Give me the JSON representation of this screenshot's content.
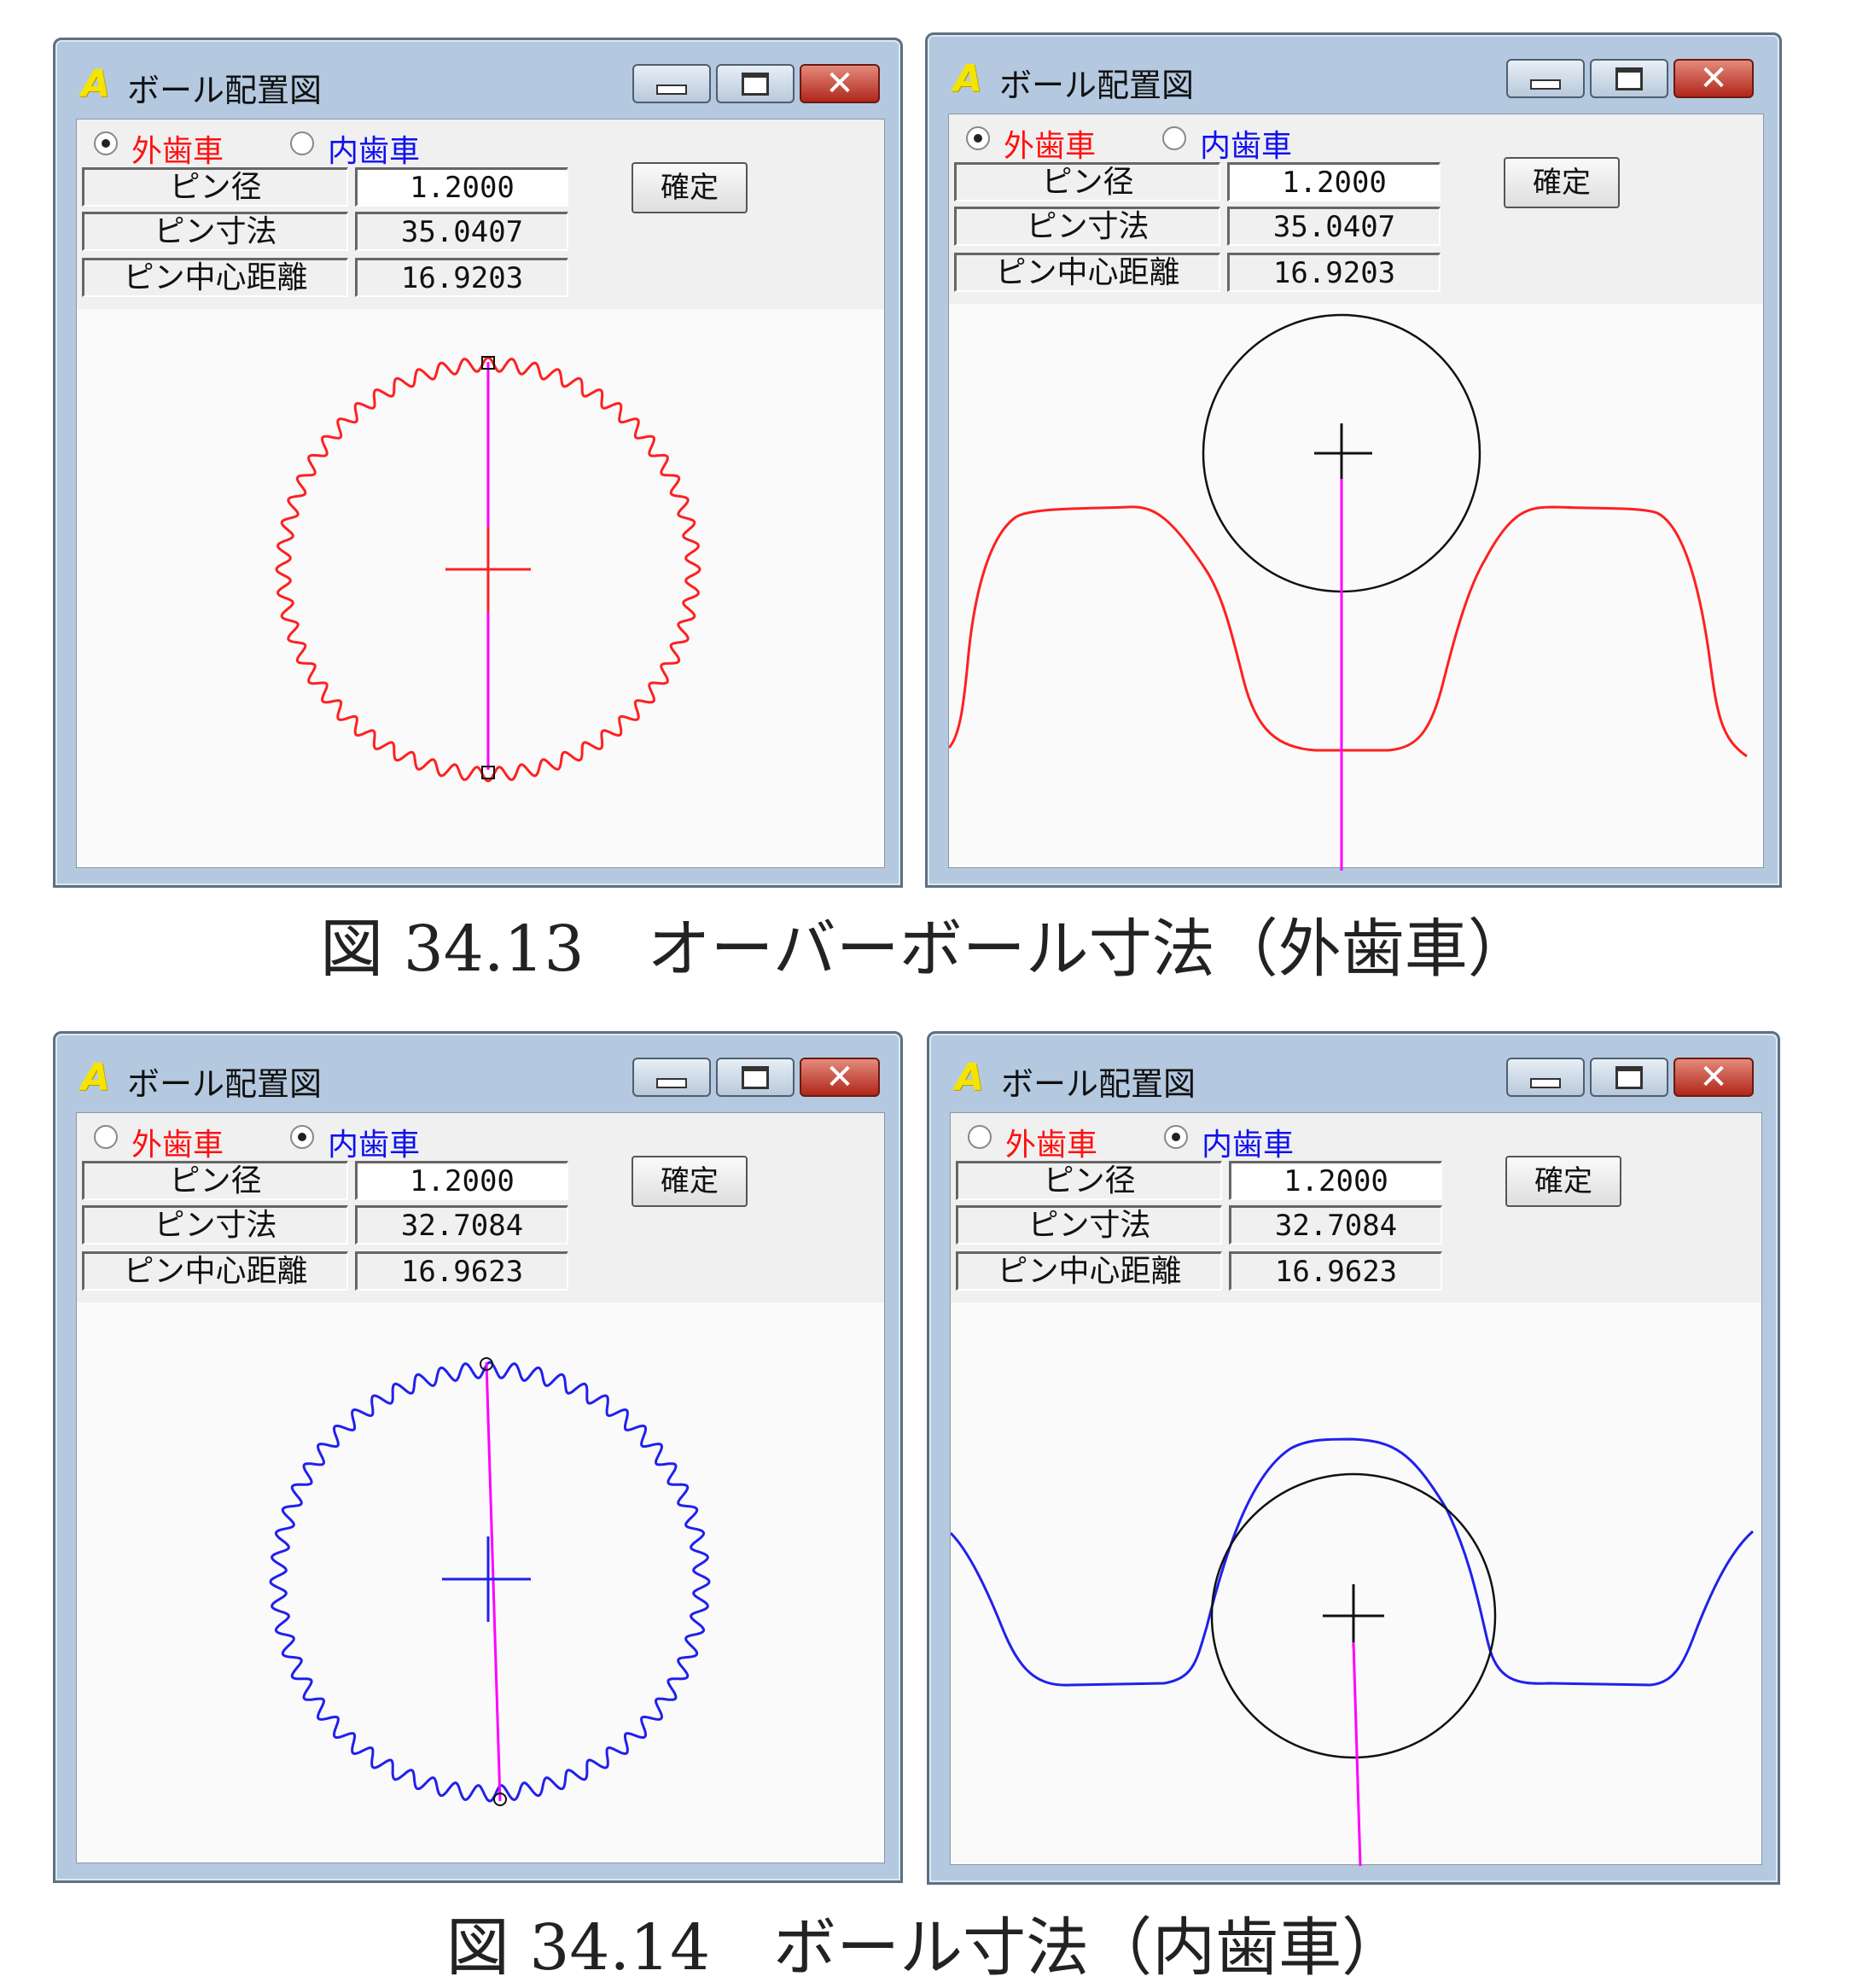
{
  "windows": [
    {
      "title": "ボール配置図",
      "radio_external": "外歯車",
      "radio_internal": "内歯車",
      "selected": "external",
      "fields": [
        {
          "label": "ピン径",
          "value": "1.2000"
        },
        {
          "label": "ピン寸法",
          "value": "35.0407"
        },
        {
          "label": "ピン中心距離",
          "value": "16.9203"
        }
      ],
      "ok_label": "確定",
      "view": "full-gear",
      "gear_color": "#ff2020"
    },
    {
      "title": "ボール配置図",
      "radio_external": "外歯車",
      "radio_internal": "内歯車",
      "selected": "external",
      "fields": [
        {
          "label": "ピン径",
          "value": "1.2000"
        },
        {
          "label": "ピン寸法",
          "value": "35.0407"
        },
        {
          "label": "ピン中心距離",
          "value": "16.9203"
        }
      ],
      "ok_label": "確定",
      "view": "zoomed-tooth",
      "gear_color": "#ff2020"
    },
    {
      "title": "ボール配置図",
      "radio_external": "外歯車",
      "radio_internal": "内歯車",
      "selected": "internal",
      "fields": [
        {
          "label": "ピン径",
          "value": "1.2000"
        },
        {
          "label": "ピン寸法",
          "value": "32.7084"
        },
        {
          "label": "ピン中心距離",
          "value": "16.9623"
        }
      ],
      "ok_label": "確定",
      "view": "full-gear",
      "gear_color": "#2020ee"
    },
    {
      "title": "ボール配置図",
      "radio_external": "外歯車",
      "radio_internal": "内歯車",
      "selected": "internal",
      "fields": [
        {
          "label": "ピン径",
          "value": "1.2000"
        },
        {
          "label": "ピン寸法",
          "value": "32.7084"
        },
        {
          "label": "ピン中心距離",
          "value": "16.9623"
        }
      ],
      "ok_label": "確定",
      "view": "zoomed-tooth",
      "gear_color": "#2020ee"
    }
  ],
  "captions": {
    "fig1": "図 34.13　オーバーボール寸法（外歯車）",
    "fig2": "図 34.14　ボール寸法（内歯車）"
  },
  "colors": {
    "external_label": "#ff1010",
    "internal_label": "#1010ee",
    "measure_line": "#ff00ff"
  }
}
